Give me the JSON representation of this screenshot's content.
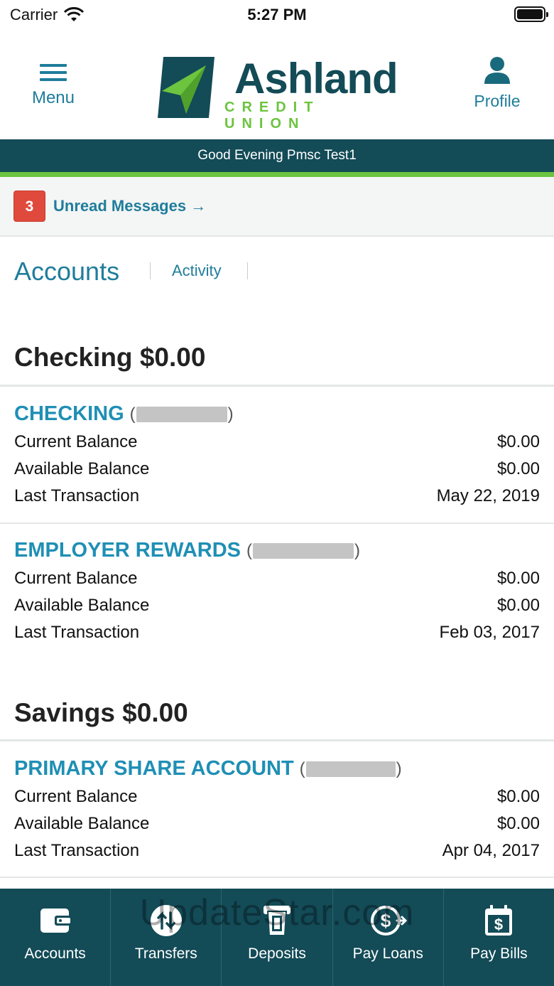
{
  "status_bar": {
    "carrier": "Carrier",
    "time": "5:27 PM"
  },
  "header": {
    "menu_label": "Menu",
    "profile_label": "Profile",
    "logo_name": "Ashland",
    "logo_sub": "CREDIT UNION"
  },
  "greeting": "Good Evening Pmsc Test1",
  "messages": {
    "count": "3",
    "label": "Unread Messages →"
  },
  "tabs": {
    "accounts": "Accounts",
    "activity": "Activity"
  },
  "sections": [
    {
      "title": "Checking $0.00",
      "accounts": [
        {
          "name": "CHECKING",
          "rows": [
            {
              "label": "Current Balance",
              "value": "$0.00"
            },
            {
              "label": "Available Balance",
              "value": "$0.00"
            },
            {
              "label": "Last Transaction",
              "value": "May 22, 2019"
            }
          ]
        },
        {
          "name": "EMPLOYER REWARDS",
          "rows": [
            {
              "label": "Current Balance",
              "value": "$0.00"
            },
            {
              "label": "Available Balance",
              "value": "$0.00"
            },
            {
              "label": "Last Transaction",
              "value": "Feb 03, 2017"
            }
          ]
        }
      ]
    },
    {
      "title": "Savings $0.00",
      "accounts": [
        {
          "name": "PRIMARY SHARE ACCOUNT",
          "rows": [
            {
              "label": "Current Balance",
              "value": "$0.00"
            },
            {
              "label": "Available Balance",
              "value": "$0.00"
            },
            {
              "label": "Last Transaction",
              "value": "Apr 04, 2017"
            }
          ]
        }
      ]
    }
  ],
  "bottom_nav": [
    {
      "label": "Accounts",
      "icon": "wallet-icon"
    },
    {
      "label": "Transfers",
      "icon": "transfer-icon"
    },
    {
      "label": "Deposits",
      "icon": "deposit-icon"
    },
    {
      "label": "Pay Loans",
      "icon": "pay-loans-icon"
    },
    {
      "label": "Pay Bills",
      "icon": "pay-bills-icon"
    }
  ],
  "watermark": "UpdateStar.com",
  "colors": {
    "brand_dark": "#134b57",
    "brand_green": "#6cc43f",
    "link_blue": "#1f7d9b",
    "badge_red": "#e04a3c"
  }
}
